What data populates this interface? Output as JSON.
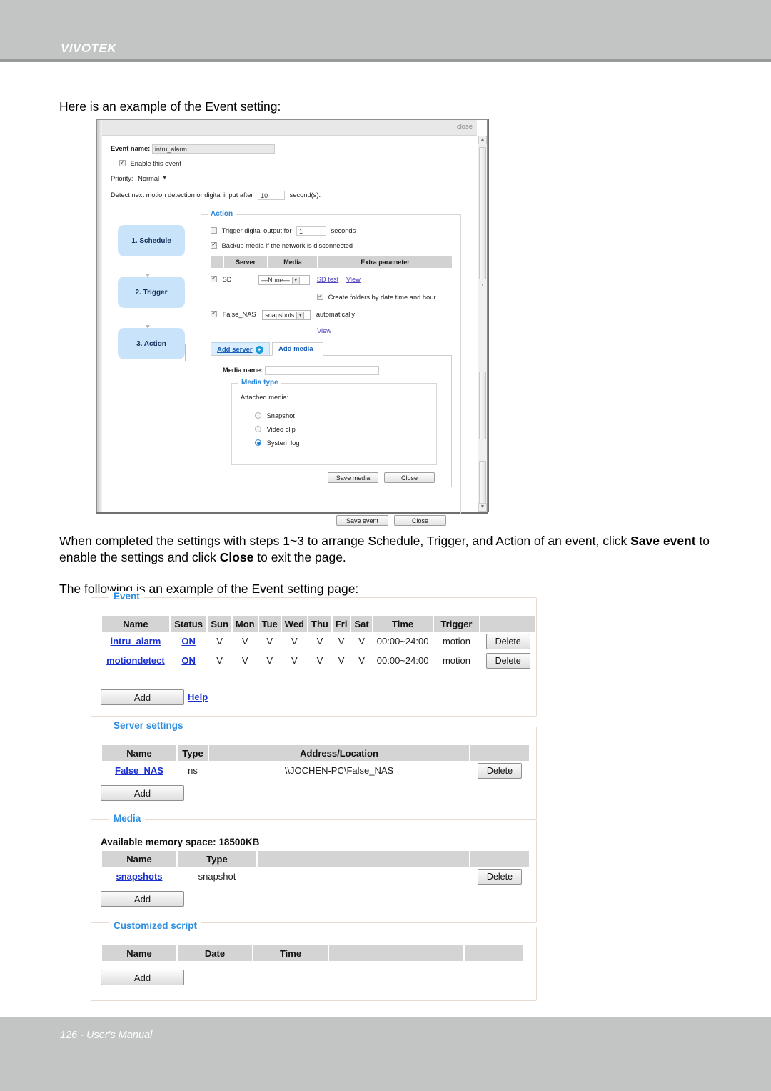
{
  "header": {
    "brand": "VIVOTEK"
  },
  "footer": {
    "text": "126 - User's Manual"
  },
  "prose": {
    "intro": "Here is an example of the Event setting:",
    "para2_a": "When completed the settings with steps 1~3 to arrange Schedule, Trigger, and Action of an event, click ",
    "para2_b": "Save event",
    "para2_c": " to enable the settings and click ",
    "para2_d": "Close",
    "para2_e": " to exit the page.",
    "para3": "The following is an example of the Event setting page:"
  },
  "event_dialog": {
    "close_link": "close",
    "event_name_label": "Event name:",
    "event_name_value": "intru_alarm",
    "enable_label": "Enable this event",
    "enable_checked": true,
    "priority_label": "Priority:",
    "priority_value": "Normal",
    "detect_label_a": "Detect next motion detection or digital input after",
    "detect_value": "10",
    "detect_label_b": "second(s).",
    "steps": [
      {
        "label": "1. Schedule"
      },
      {
        "label": "2. Trigger"
      },
      {
        "label": "3. Action"
      }
    ],
    "action": {
      "legend": "Action",
      "trigger_do_label_a": "Trigger digital output for",
      "trigger_do_value": "1",
      "trigger_do_label_b": "seconds",
      "trigger_do_checked": false,
      "backup_label": "Backup media if the network is disconnected",
      "backup_checked": true,
      "table_headers": [
        "Server",
        "Media",
        "Extra parameter"
      ],
      "rows": [
        {
          "server": "SD",
          "checked": true,
          "media": "—None—",
          "links": [
            "SD test",
            "View"
          ],
          "sub_label": "Create folders by date time and hour",
          "sub_checked": true
        },
        {
          "server": "False_NAS",
          "checked": true,
          "media": "snapshots",
          "suffix": "automatically",
          "links": [
            "View"
          ]
        }
      ],
      "tabs": [
        {
          "label": "Add server",
          "active": false,
          "has_dot": true
        },
        {
          "label": "Add media",
          "active": true,
          "has_dot": false
        }
      ],
      "media_name_label": "Media name:",
      "media_name_value": "",
      "media_type_legend": "Media type",
      "attached_media_label": "Attached media:",
      "media_options": [
        {
          "label": "Snapshot",
          "selected": false
        },
        {
          "label": "Video clip",
          "selected": false
        },
        {
          "label": "System log",
          "selected": true
        }
      ],
      "save_media_button": "Save media",
      "close_media_button": "Close"
    },
    "save_event_button": "Save event",
    "close_event_button": "Close"
  },
  "event_page": {
    "event_panel": {
      "legend": "Event",
      "headers": [
        "Name",
        "Status",
        "Sun",
        "Mon",
        "Tue",
        "Wed",
        "Thu",
        "Fri",
        "Sat",
        "Time",
        "Trigger",
        ""
      ],
      "rows": [
        {
          "name": "intru_alarm",
          "status": "ON",
          "days": [
            "V",
            "V",
            "V",
            "V",
            "V",
            "V",
            "V"
          ],
          "time": "00:00~24:00",
          "trigger": "motion",
          "delete": "Delete"
        },
        {
          "name": "motiondetect",
          "status": "ON",
          "days": [
            "V",
            "V",
            "V",
            "V",
            "V",
            "V",
            "V"
          ],
          "time": "00:00~24:00",
          "trigger": "motion",
          "delete": "Delete"
        }
      ],
      "add_button": "Add",
      "help_link": "Help"
    },
    "server_panel": {
      "legend": "Server settings",
      "headers": [
        "Name",
        "Type",
        "Address/Location",
        ""
      ],
      "rows": [
        {
          "name": "False_NAS",
          "type": "ns",
          "address": "\\\\JOCHEN-PC\\False_NAS",
          "delete": "Delete"
        }
      ],
      "add_button": "Add"
    },
    "media_panel": {
      "legend": "Media",
      "memory_text": "Available memory space: 18500KB",
      "headers": [
        "Name",
        "Type",
        "",
        ""
      ],
      "rows": [
        {
          "name": "snapshots",
          "type": "snapshot",
          "delete": "Delete"
        }
      ],
      "add_button": "Add"
    },
    "script_panel": {
      "legend": "Customized script",
      "headers": [
        "Name",
        "Date",
        "Time",
        "",
        ""
      ],
      "rows": [],
      "add_button": "Add"
    }
  },
  "colors": {
    "band": "#c3c5c4",
    "legend_blue": "#2f8ee0",
    "link_blue": "#1a2fd0",
    "step_blue": "#c9e4fa",
    "table_header_gray": "#d4d4d4"
  }
}
